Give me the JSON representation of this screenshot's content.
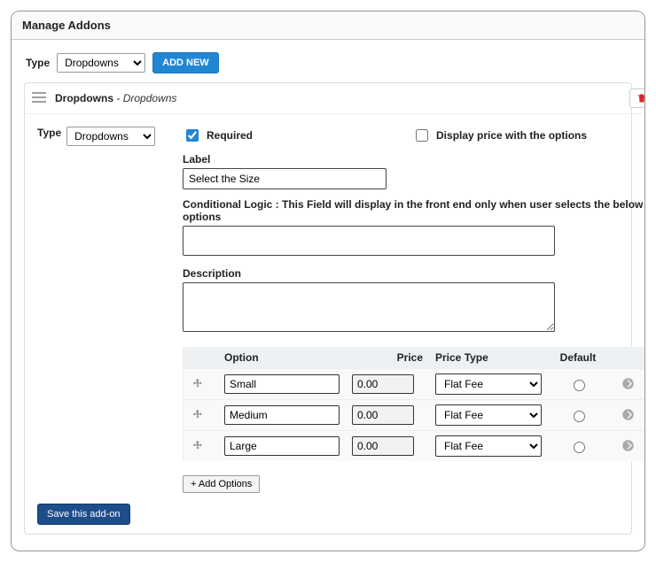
{
  "title": "Manage Addons",
  "top": {
    "type_label": "Type",
    "type_value": "Dropdowns",
    "add_new": "ADD NEW"
  },
  "addon": {
    "header_title": "Dropdowns",
    "header_subtitle": "Dropdowns",
    "inner_type_label": "Type",
    "inner_type_value": "Dropdowns",
    "required_label": "Required",
    "required_checked": true,
    "display_price_label": "Display price with the options",
    "display_price_checked": false,
    "label_heading": "Label",
    "label_value": "Select the Size",
    "cond_heading": "Conditional Logic : This Field will display in the front end only when user selects the below options",
    "cond_value": "",
    "desc_heading": "Description",
    "desc_value": "",
    "table": {
      "col_option": "Option",
      "col_price": "Price",
      "col_price_type": "Price Type",
      "col_default": "Default",
      "rows": [
        {
          "option": "Small",
          "price": "0.00",
          "price_type": "Flat Fee",
          "default": false
        },
        {
          "option": "Medium",
          "price": "0.00",
          "price_type": "Flat Fee",
          "default": false
        },
        {
          "option": "Large",
          "price": "0.00",
          "price_type": "Flat Fee",
          "default": false
        }
      ]
    },
    "add_options_btn": "+ Add Options",
    "save_btn": "Save this add-on"
  }
}
